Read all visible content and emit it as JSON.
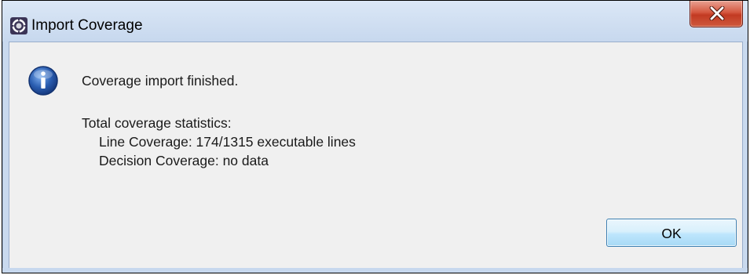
{
  "window": {
    "title": "Import Coverage",
    "app_icon": "eclipse-gear-icon",
    "close_icon": "close-x-icon"
  },
  "dialog": {
    "icon": "info-icon",
    "message": "Coverage import finished.",
    "stats_heading": "Total coverage statistics:",
    "line_coverage": "Line Coverage: 174/1315 executable lines",
    "decision_coverage": "Decision Coverage: no data"
  },
  "buttons": {
    "ok_label": "OK"
  },
  "colors": {
    "titlebar": "#c7d8ee",
    "client_background": "#f0f0f0",
    "close_button": "#c7452c",
    "info_icon": "#2a5db0"
  }
}
